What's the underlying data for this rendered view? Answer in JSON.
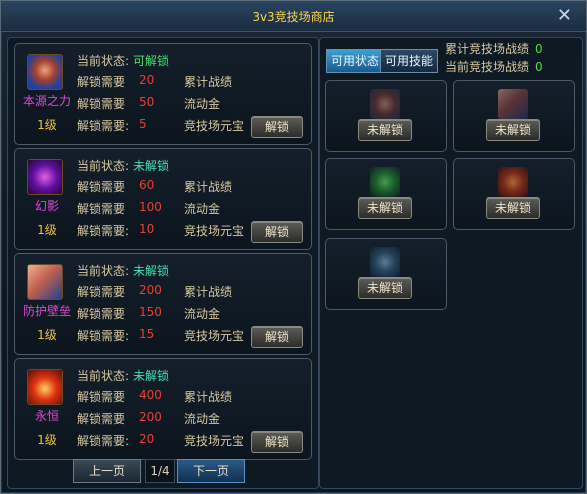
{
  "window": {
    "title": "3v3竞技场商店"
  },
  "tabs": [
    {
      "label": "可用状态",
      "active": true
    },
    {
      "label": "可用技能",
      "active": false
    }
  ],
  "info": {
    "total_label": "累计竞技场战绩",
    "total_value": "0",
    "current_label": "当前竞技场战绩",
    "current_value": "0"
  },
  "status_label": "当前状态:",
  "req_label": "解锁需要",
  "req_label_colon": "解锁需要:",
  "unlock_label": "解锁",
  "skills": [
    {
      "name": "本源之力",
      "level": "1级",
      "status": "可解锁",
      "req": [
        {
          "v": "20",
          "t": "累计战绩"
        },
        {
          "v": "50",
          "t": "流动金"
        },
        {
          "v": "5",
          "t": "竞技场元宝"
        }
      ]
    },
    {
      "name": "幻影",
      "level": "1级",
      "status": "未解锁",
      "req": [
        {
          "v": "60",
          "t": "累计战绩"
        },
        {
          "v": "100",
          "t": "流动金"
        },
        {
          "v": "10",
          "t": "竞技场元宝"
        }
      ]
    },
    {
      "name": "防护壁垒",
      "level": "1级",
      "status": "未解锁",
      "req": [
        {
          "v": "200",
          "t": "累计战绩"
        },
        {
          "v": "150",
          "t": "流动金"
        },
        {
          "v": "15",
          "t": "竞技场元宝"
        }
      ]
    },
    {
      "name": "永恒",
      "level": "1级",
      "status": "未解锁",
      "req": [
        {
          "v": "400",
          "t": "累计战绩"
        },
        {
          "v": "200",
          "t": "流动金"
        },
        {
          "v": "20",
          "t": "竞技场元宝"
        }
      ]
    }
  ],
  "slots": [
    {
      "label": "未解锁",
      "icon": "fist-icon"
    },
    {
      "label": "未解锁",
      "icon": "shield-icon"
    },
    {
      "label": "未解锁",
      "icon": "green-orb-icon"
    },
    {
      "label": "未解锁",
      "icon": "fire-orb-icon"
    },
    {
      "label": "未解锁",
      "icon": "figure-icon"
    }
  ],
  "pager": {
    "prev": "上一页",
    "page": "1/4",
    "next": "下一页"
  },
  "colors": {
    "title": "#ffd24a",
    "skill_name": "#e048d8",
    "value": "#e84030",
    "ok": "#40e070"
  }
}
